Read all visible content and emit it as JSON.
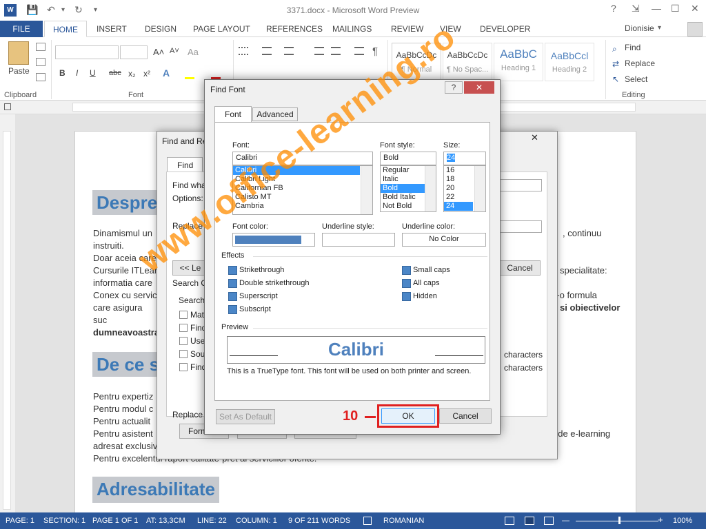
{
  "window": {
    "title": "3371.docx - Microsoft Word Preview",
    "app_icon": "W",
    "help": "?",
    "ribbon_options": "⇲",
    "minimize": "—",
    "maximize": "☐",
    "close": "✕"
  },
  "qat": {
    "save": "💾",
    "undo": "↶",
    "undo_arrow": "▾",
    "redo": "↻",
    "customize": "▾"
  },
  "tabs": [
    "HOME",
    "INSERT",
    "DESIGN",
    "PAGE LAYOUT",
    "REFERENCES",
    "MAILINGS",
    "REVIEW",
    "VIEW",
    "DEVELOPER"
  ],
  "file_tab": "FILE",
  "user": {
    "name": "Dionisie",
    "arrow": "▾"
  },
  "ribbon": {
    "paste_label": "Paste",
    "clipboard_label": "Clipboard",
    "font_label": "Font",
    "editing_label": "Editing",
    "font_buttons": [
      "B",
      "I",
      "U",
      "abc",
      "x₂",
      "x²"
    ],
    "grow_font": "A˄",
    "shrink_font": "A˅",
    "change_case": "Aa",
    "styles": [
      {
        "sample": "AaBbCcDc",
        "name": "¶ Normal"
      },
      {
        "sample": "AaBbCcDc",
        "name": "¶ No Spac..."
      },
      {
        "sample": "AaBbC",
        "name": "Heading 1"
      },
      {
        "sample": "AaBbCcl",
        "name": "Heading 2"
      }
    ],
    "find": "Find",
    "replace": "Replace",
    "select": "Select"
  },
  "document": {
    "heading1": "Despre",
    "lines1": [
      "Dinamismul un",
      "instruiti.",
      "Doar aceia care",
      "Cursurile ITLear",
      "informatia care",
      "Conex cu servic",
      "care asigura suc",
      "dumneavoastra"
    ],
    "right1": [
      ", continuu",
      "specialitate:",
      "r-o formula",
      "si obiectivelor"
    ],
    "heading2": "De ce s",
    "lines2": [
      "Pentru expertiz",
      "Pentru modul c",
      "Pentru actualit",
      "Pentru asistent",
      "adresat exclusiv",
      "Pentru excelentul raport calitate-pret al serviciilor oferite."
    ],
    "right2": ": de e-learning"
  },
  "heading3": "Adresabilitate",
  "status": {
    "page": "PAGE: 1",
    "section": "SECTION: 1",
    "page_of": "PAGE 1 OF 1",
    "at": "AT: 13,3CM",
    "line": "LINE: 22",
    "column": "COLUMN: 1",
    "words": "9 OF 211 WORDS",
    "language": "ROMANIAN",
    "zoom": "100%",
    "zoom_out": "—",
    "zoom_in": "+"
  },
  "find_replace": {
    "title": "Find and Re",
    "tab_find": "Find",
    "find_what": "Find wha",
    "options": "Options:",
    "replace_with": "Replace w",
    "less": "<< Le",
    "cancel": "Cancel",
    "search_opts": "Search O",
    "search": "Search:",
    "checkboxes": [
      "Mat",
      "Find",
      "Use",
      "Sou",
      "Find"
    ],
    "right_checks": [
      "characters",
      "characters"
    ],
    "replace_section": "Replace",
    "format": "Form"
  },
  "find_font": {
    "title": "Find Font",
    "help": "?",
    "close": "✕",
    "tabs": [
      "Font",
      "Advanced"
    ],
    "font_label": "Font:",
    "font_value": "Calibri",
    "fonts": [
      "Calibri",
      "Calibri Light",
      "Californian FB",
      "Calisto MT",
      "Cambria"
    ],
    "style_label": "Font style:",
    "style_value": "Bold",
    "styles": [
      "Regular",
      "Italic",
      "Bold",
      "Bold Italic",
      "Not Bold"
    ],
    "size_label": "Size:",
    "size_value": "24",
    "sizes": [
      "16",
      "18",
      "20",
      "22",
      "24"
    ],
    "font_color_label": "Font color:",
    "underline_style_label": "Underline style:",
    "underline_color_label": "Underline color:",
    "underline_color_value": "No Color",
    "effects_label": "Effects",
    "effects_left": [
      "Strikethrough",
      "Double strikethrough",
      "Superscript",
      "Subscript"
    ],
    "effects_right": [
      "Small caps",
      "All caps",
      "Hidden"
    ],
    "preview_label": "Preview",
    "preview_text": "Calibri",
    "preview_note": "This is a TrueType font. This font will be used on both printer and screen.",
    "set_default": "Set As Default",
    "ok": "OK",
    "cancel": "Cancel",
    "step_number": "10",
    "font_color_hex": "#4f81bd",
    "highlight_color": "#e02020"
  },
  "watermark": "www.office-learning.ro"
}
